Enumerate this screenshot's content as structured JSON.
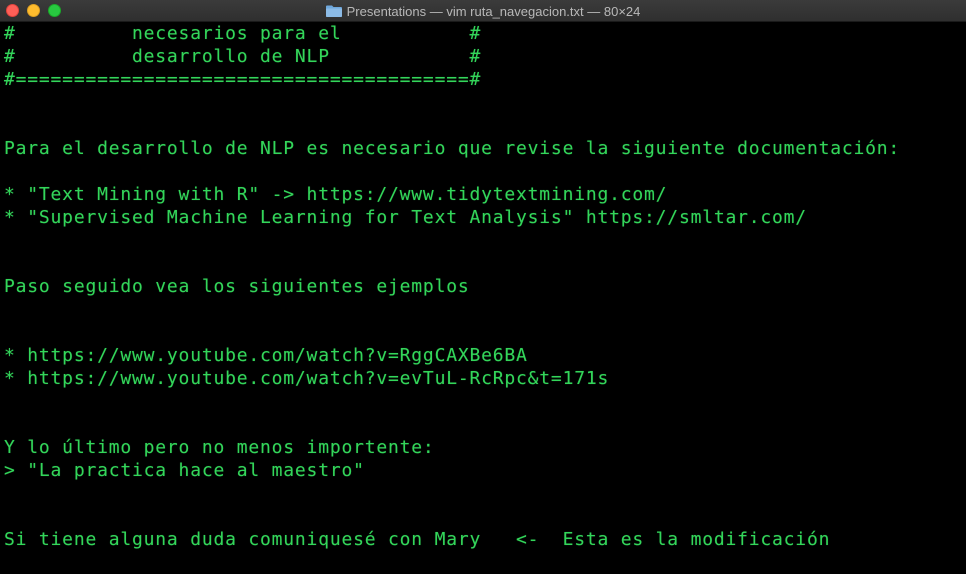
{
  "window": {
    "title": "Presentations — vim ruta_navegacion.txt — 80×24",
    "folder_icon": "folder-icon",
    "buttons": {
      "close": "close-icon",
      "minimize": "minimize-icon",
      "zoom": "zoom-icon"
    }
  },
  "colors": {
    "terminal_text": "#33d65a",
    "terminal_bg": "#000000"
  },
  "terminal": {
    "lines": [
      "#          necesarios para el           #",
      "#          desarrollo de NLP            #",
      "#=======================================#",
      "",
      "",
      "Para el desarrollo de NLP es necesario que revise la siguiente documentación:",
      "",
      "* \"Text Mining with R\" -> https://www.tidytextmining.com/",
      "* \"Supervised Machine Learning for Text Analysis\" https://smltar.com/",
      "",
      "",
      "Paso seguido vea los siguientes ejemplos",
      "",
      "",
      "* https://www.youtube.com/watch?v=RggCAXBe6BA",
      "* https://www.youtube.com/watch?v=evTuL-RcRpc&t=171s",
      "",
      "",
      "Y lo último pero no menos importente:",
      "> \"La practica hace al maestro\"",
      "",
      "",
      "Si tiene alguna duda comuniquesé con Mary   <-  Esta es la modificación",
      ""
    ]
  }
}
